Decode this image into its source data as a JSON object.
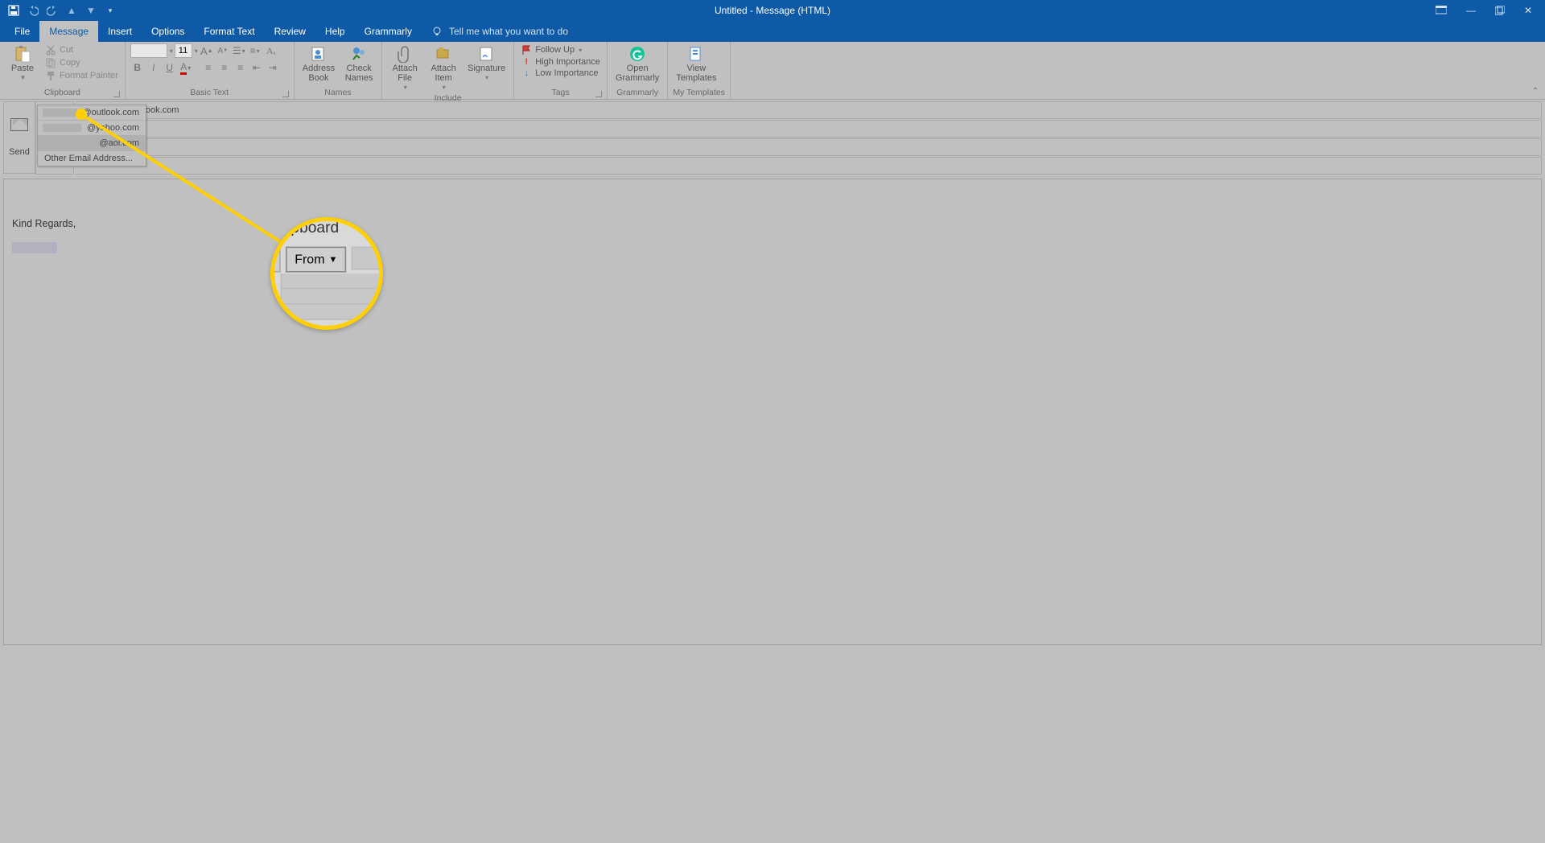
{
  "window": {
    "title": "Untitled - Message (HTML)"
  },
  "tabs": {
    "file": "File",
    "message": "Message",
    "insert": "Insert",
    "options": "Options",
    "format_text": "Format Text",
    "review": "Review",
    "help": "Help",
    "grammarly": "Grammarly",
    "tell_me": "Tell me what you want to do"
  },
  "ribbon": {
    "clipboard": {
      "label": "Clipboard",
      "paste": "Paste",
      "cut": "Cut",
      "copy": "Copy",
      "format_painter": "Format Painter"
    },
    "basic_text": {
      "label": "Basic Text",
      "font_name": "",
      "font_size": "11"
    },
    "names": {
      "label": "Names",
      "address_book": "Address\nBook",
      "check_names": "Check\nNames"
    },
    "include": {
      "label": "Include",
      "attach_file": "Attach\nFile",
      "attach_item": "Attach\nItem",
      "signature": "Signature"
    },
    "tags": {
      "label": "Tags",
      "follow_up": "Follow Up",
      "high": "High Importance",
      "low": "Low Importance"
    },
    "grammarly": {
      "label": "Grammarly",
      "open": "Open\nGrammarly"
    },
    "templates": {
      "label": "My Templates",
      "view": "View\nTemplates"
    }
  },
  "header": {
    "send": "Send",
    "from_label": "From",
    "from_value": "@outlook.com",
    "from_menu": {
      "opt1": "@outlook.com",
      "opt2": "@yahoo.com",
      "opt3": "@aol.com",
      "other": "Other Email Address..."
    }
  },
  "body": {
    "signature": "Kind Regards,"
  },
  "callout": {
    "clipboard_label": "Clipboard",
    "from_label": "From"
  }
}
